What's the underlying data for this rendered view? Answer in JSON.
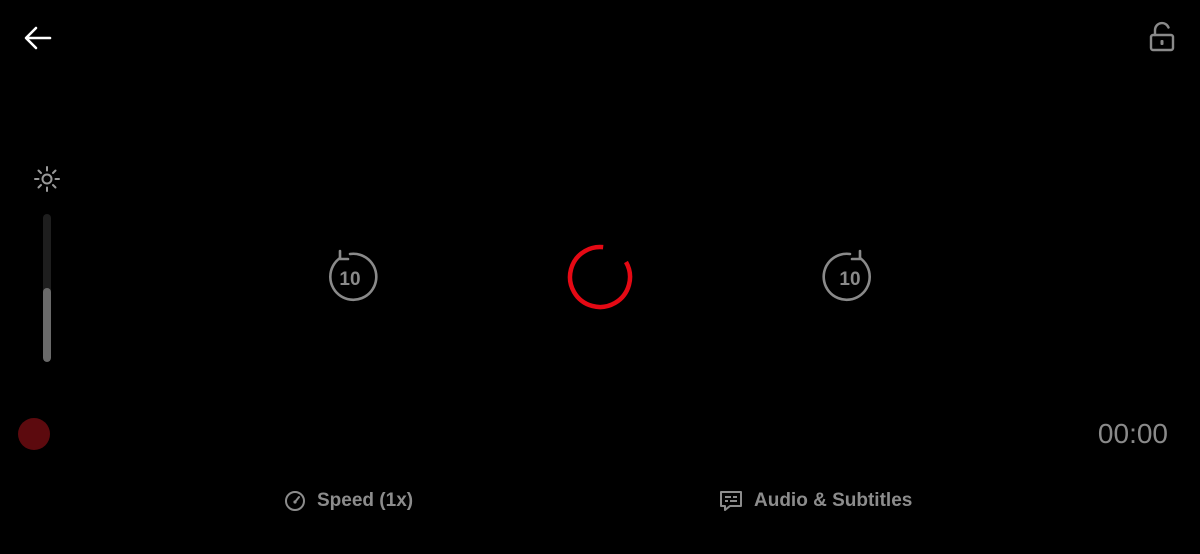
{
  "player": {
    "time": "00:00",
    "brightness_level": 0.5,
    "rewind_seconds": "10",
    "forward_seconds": "10"
  },
  "controls": {
    "speed_label": "Speed (1x)",
    "audio_subtitles_label": "Audio & Subtitles"
  },
  "icons": {
    "back": "arrow-left-icon",
    "lock": "unlock-icon",
    "brightness": "sun-icon",
    "rewind": "rewind-10-icon",
    "forward": "forward-10-icon",
    "loading": "loading-spinner",
    "speed": "speedometer-icon",
    "subtitles": "subtitles-icon"
  },
  "colors": {
    "background": "#000000",
    "accent": "#e50914",
    "scrub_handle": "#5c0a0e",
    "icon": "#9a9a9a",
    "text": "#8c8c8c"
  }
}
